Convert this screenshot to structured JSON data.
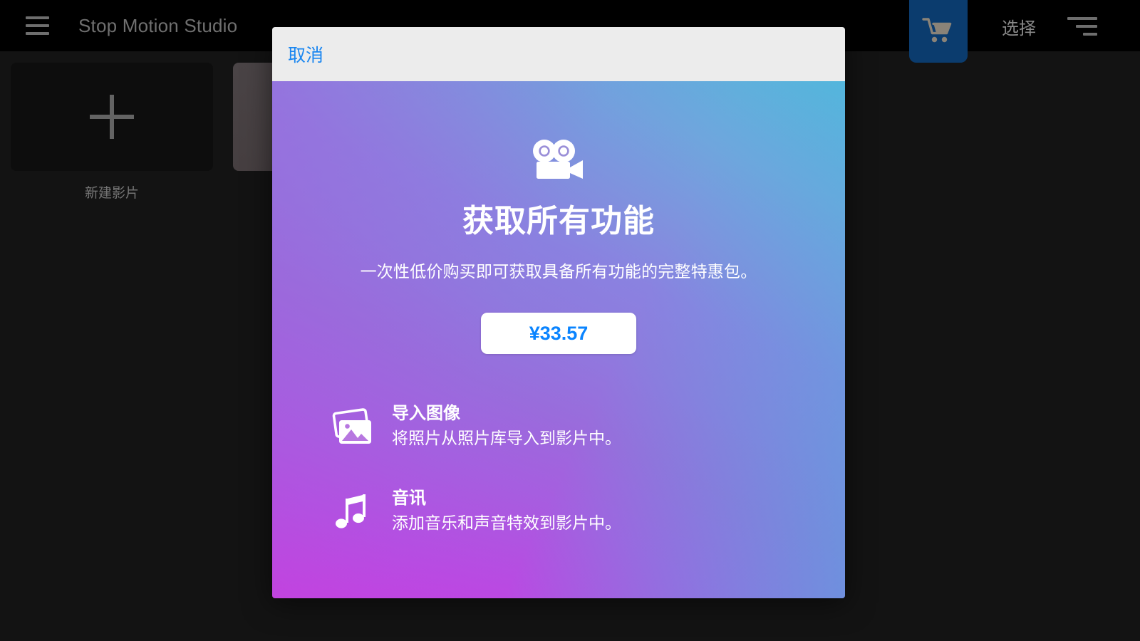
{
  "app": {
    "title": "Stop Motion Studio",
    "header": {
      "menu_icon": "hamburger-menu-icon",
      "cart_icon": "shopping-cart-icon",
      "select_label": "选择",
      "sort_icon": "sort-list-icon",
      "cart_highlight_color": "#0b3c6e"
    },
    "projects": [
      {
        "label": "新建影片",
        "type": "new",
        "icon": "plus-icon"
      },
      {
        "label": "",
        "type": "thumbnail",
        "icon": ""
      }
    ]
  },
  "dialog": {
    "cancel_label": "取消",
    "header_bg": "#ececec",
    "cancel_color": "#1a86f0",
    "hero": {
      "icon": "movie-camera-icon",
      "title": "获取所有功能",
      "subtitle": "一次性低价购买即可获取具备所有功能的完整特惠包。"
    },
    "price_button": {
      "label": "¥33.57",
      "text_color": "#0a84ff",
      "background": "#ffffff"
    },
    "features": [
      {
        "icon": "photos-stack-icon",
        "title": "导入图像",
        "description": "将照片从照片库导入到影片中。"
      },
      {
        "icon": "music-note-icon",
        "title": "音讯",
        "description": "添加音乐和声音特效到影片中。"
      }
    ],
    "gradient": {
      "from": "#cf36e0",
      "mid": "#8a82e0",
      "to": "#56b6dc"
    }
  }
}
